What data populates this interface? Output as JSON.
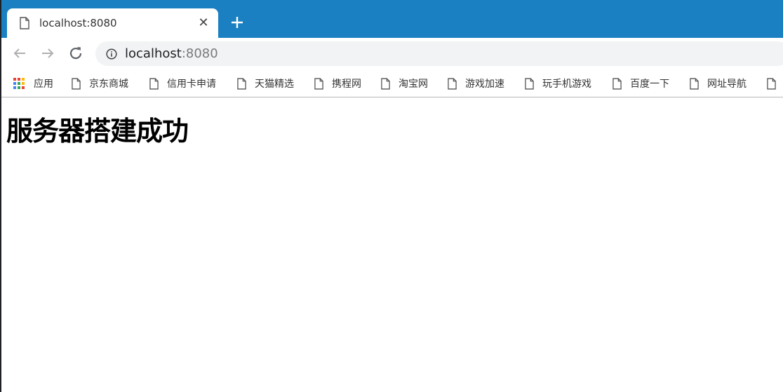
{
  "colors": {
    "tabstrip": "#1a80c1",
    "omnibox": "#f1f3f4"
  },
  "tab": {
    "title": "localhost:8080",
    "icon": "file-icon",
    "close_icon": "close-icon"
  },
  "new_tab_icon": "plus-icon",
  "toolbar": {
    "back_icon": "back-arrow-icon",
    "forward_icon": "forward-arrow-icon",
    "reload_icon": "reload-icon"
  },
  "omnibox": {
    "info_icon": "info-icon",
    "host": "localhost",
    "port": ":8080"
  },
  "bookmarks": [
    {
      "label": "应用",
      "icon": "apps-grid-icon"
    },
    {
      "label": "京东商城",
      "icon": "file-icon"
    },
    {
      "label": "信用卡申请",
      "icon": "file-icon"
    },
    {
      "label": "天猫精选",
      "icon": "file-icon"
    },
    {
      "label": "携程网",
      "icon": "file-icon"
    },
    {
      "label": "淘宝网",
      "icon": "file-icon"
    },
    {
      "label": "游戏加速",
      "icon": "file-icon"
    },
    {
      "label": "玩手机游戏",
      "icon": "file-icon"
    },
    {
      "label": "百度一下",
      "icon": "file-icon"
    },
    {
      "label": "网址导航",
      "icon": "file-icon"
    },
    {
      "label": "",
      "icon": "file-icon"
    }
  ],
  "page": {
    "heading": "服务器搭建成功"
  }
}
